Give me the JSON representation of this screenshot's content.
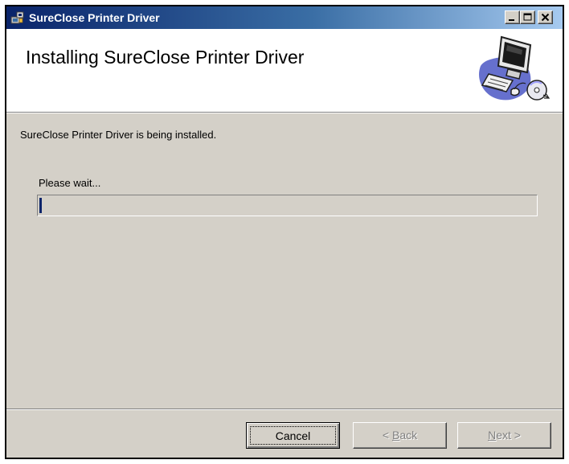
{
  "window": {
    "title": "SureClose Printer Driver",
    "controls": {
      "minimize": "minimize",
      "maximize": "maximize",
      "close": "close"
    }
  },
  "header": {
    "title": "Installing SureClose Printer Driver",
    "graphic": "computer-installer-icon"
  },
  "body": {
    "description": "SureClose Printer Driver is being installed.",
    "wait_label": "Please wait...",
    "progress": 0.005
  },
  "buttons": {
    "cancel": "Cancel",
    "back_prefix": "< ",
    "back_mnemonic": "B",
    "back_rest": "ack",
    "next_mnemonic": "N",
    "next_rest": "ext >"
  },
  "colors": {
    "titlebar_start": "#0a246a",
    "titlebar_end": "#a6caf0",
    "dialog_bg": "#d4d0c8",
    "progress_fill": "#0a246a"
  }
}
